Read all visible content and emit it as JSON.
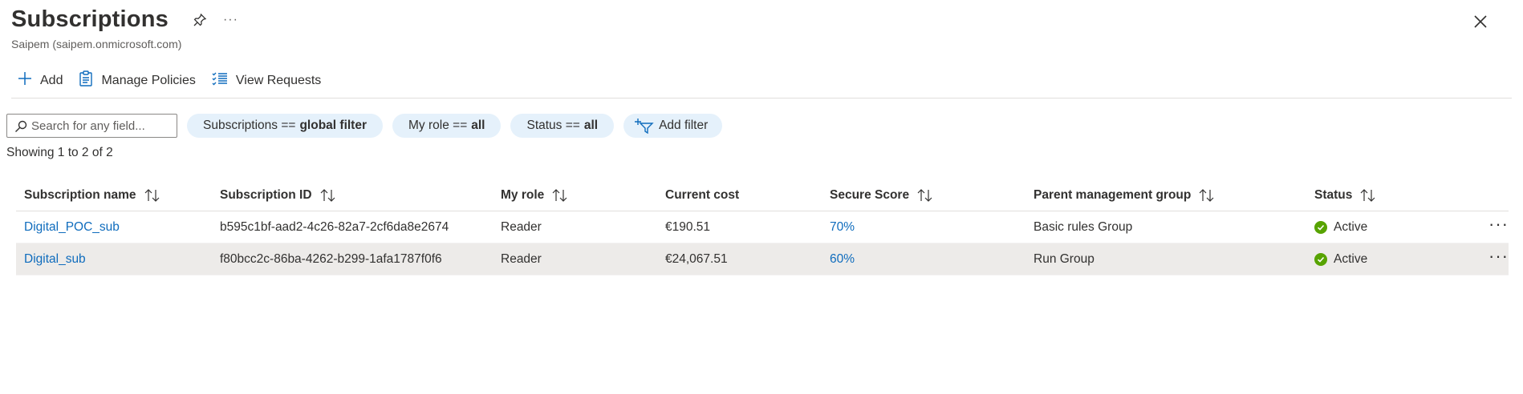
{
  "header": {
    "title": "Subscriptions",
    "subtitle": "Saipem (saipem.onmicrosoft.com)",
    "more_label": "···"
  },
  "toolbar": {
    "add_label": "Add",
    "manage_policies_label": "Manage Policies",
    "view_requests_label": "View Requests"
  },
  "filters": {
    "search_placeholder": "Search for any field...",
    "pills": [
      {
        "key": "Subscriptions ==",
        "value": "global filter"
      },
      {
        "key": "My role ==",
        "value": "all"
      },
      {
        "key": "Status ==",
        "value": "all"
      }
    ],
    "add_filter_label": "Add filter"
  },
  "showing_text": "Showing 1 to 2 of 2",
  "table": {
    "columns": [
      "Subscription name",
      "Subscription ID",
      "My role",
      "Current cost",
      "Secure Score",
      "Parent management group",
      "Status"
    ],
    "rows": [
      {
        "name": "Digital_POC_sub",
        "id": "b595c1bf-aad2-4c26-82a7-2cf6da8e2674",
        "role": "Reader",
        "cost": "€190.51",
        "score": "70%",
        "group": "Basic rules Group",
        "status": "Active"
      },
      {
        "name": "Digital_sub",
        "id": "f80bcc2c-86ba-4262-b299-1afa1787f0f6",
        "role": "Reader",
        "cost": "€24,067.51",
        "score": "60%",
        "group": "Run Group",
        "status": "Active"
      }
    ],
    "row_more_label": "···"
  },
  "colors": {
    "link": "#0f6cbd",
    "pill_bg": "#e5f1fb",
    "status_active": "#57a300",
    "row_highlight": "#edebe9"
  }
}
